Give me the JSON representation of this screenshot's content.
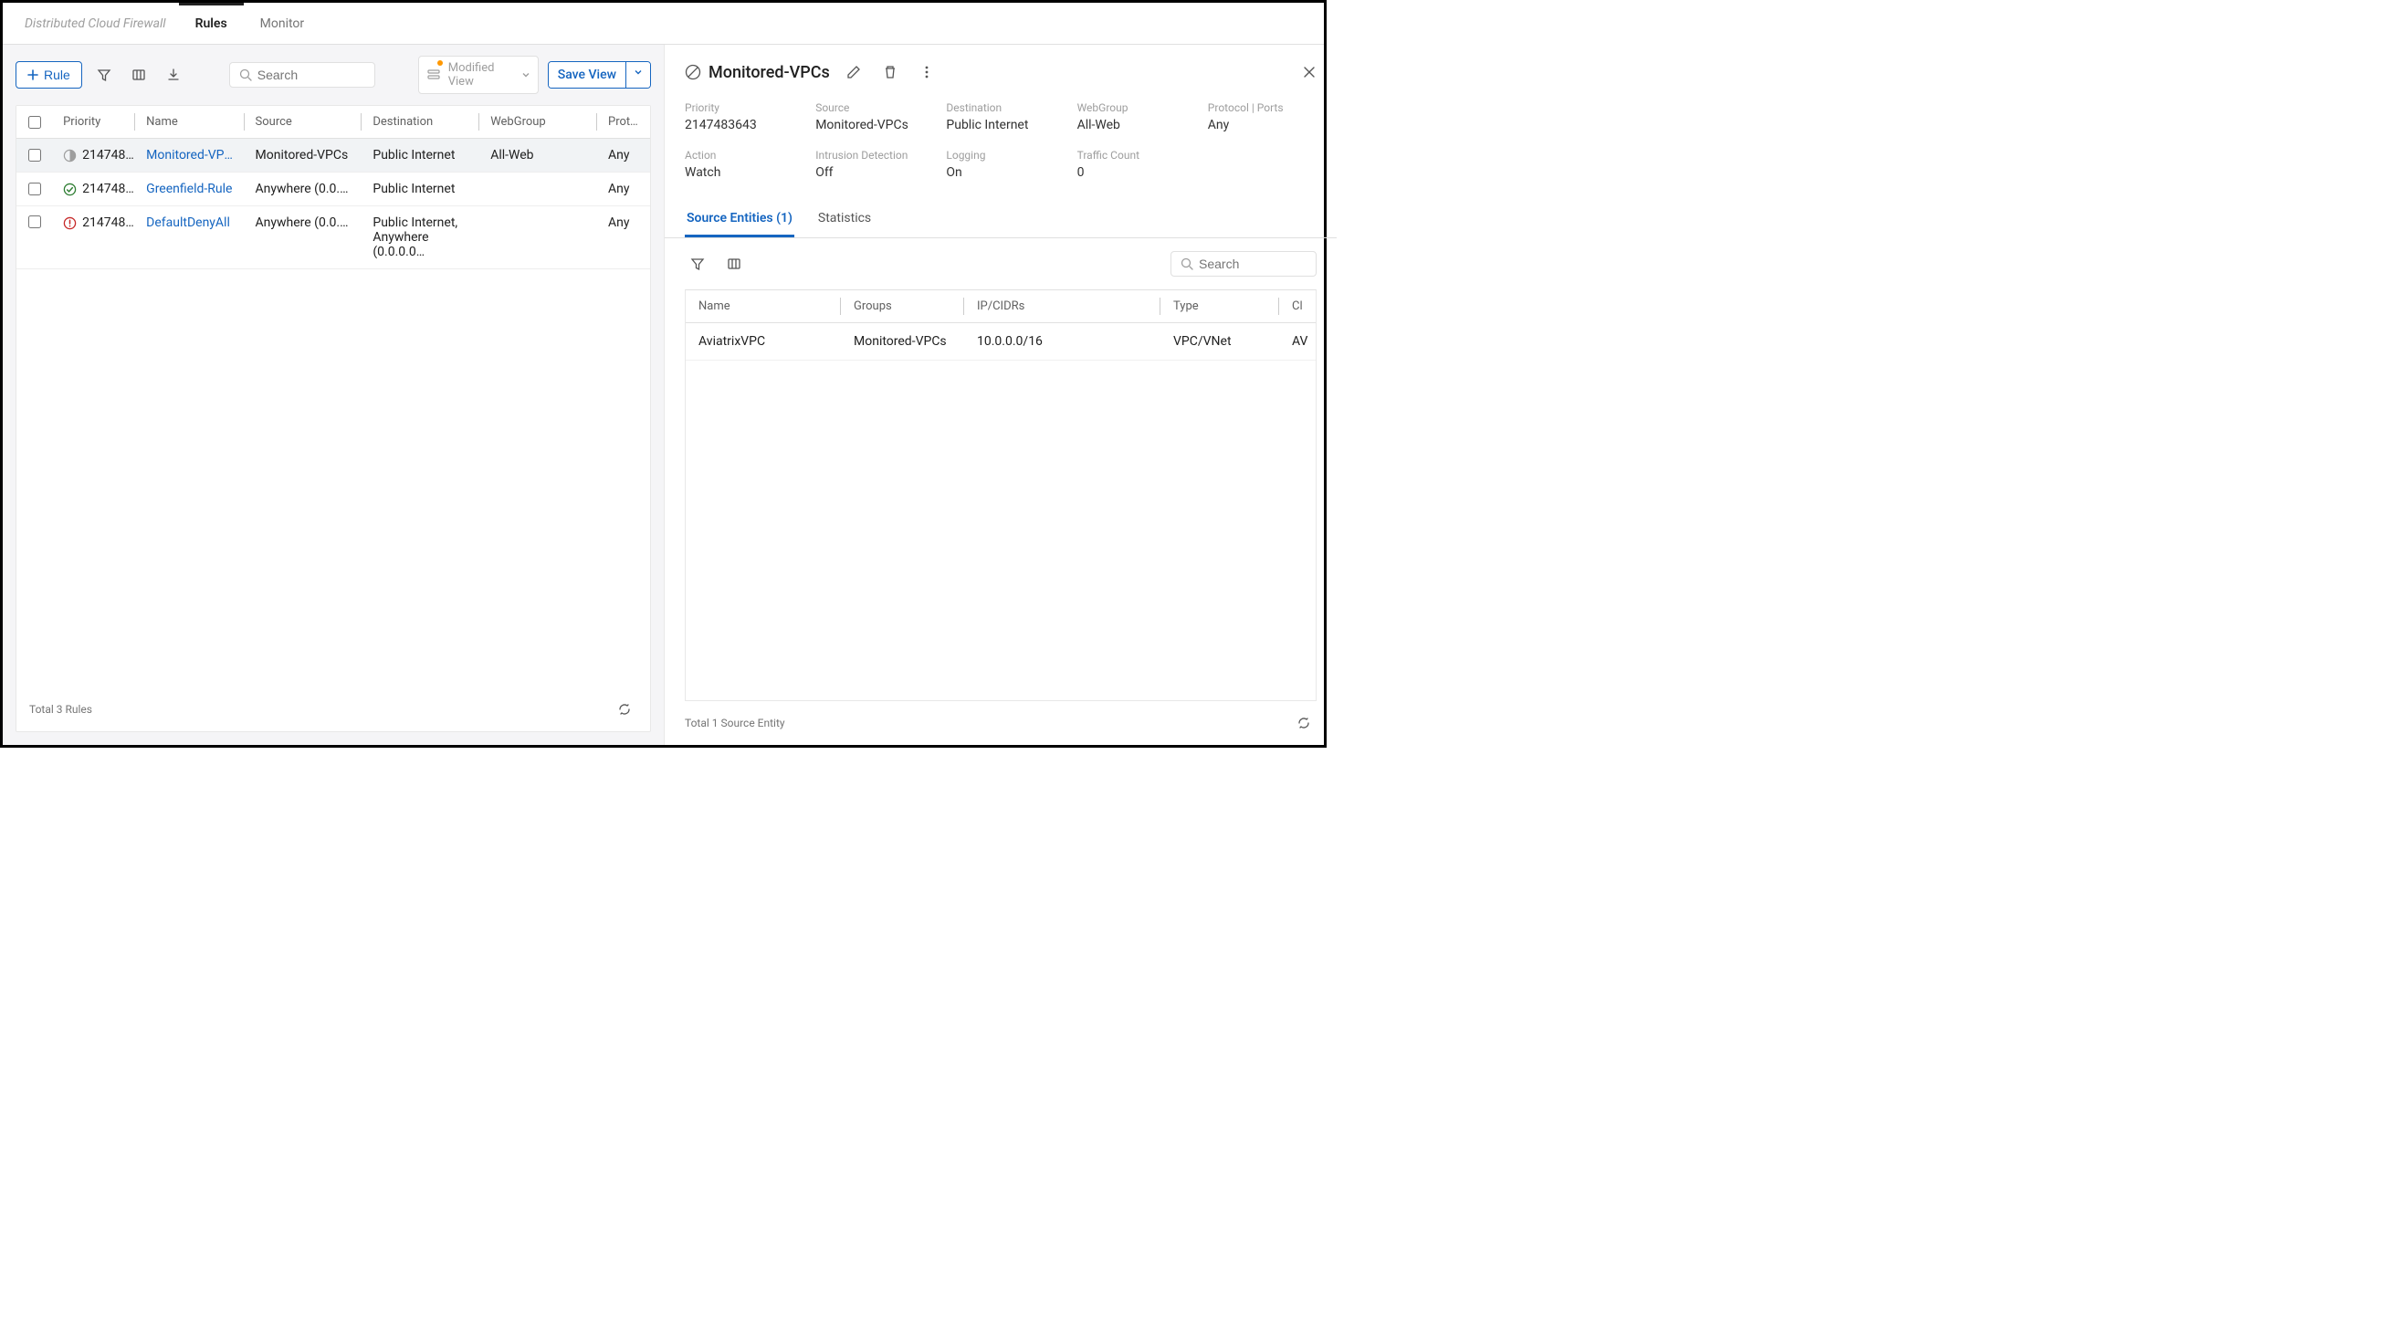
{
  "header": {
    "brand": "Distributed Cloud Firewall",
    "tabs": [
      "Rules",
      "Monitor"
    ],
    "active_tab": "Rules"
  },
  "toolbar": {
    "add_rule_label": "Rule",
    "search_placeholder": "Search",
    "modified_view_label": "Modified View",
    "save_view_label": "Save View"
  },
  "rules_table": {
    "columns": [
      "Priority",
      "Name",
      "Source",
      "Destination",
      "WebGroup",
      "Protoc"
    ],
    "rows": [
      {
        "priority": "214748…",
        "name": "Monitored-VPCs",
        "source": "Monitored-VPCs",
        "destination": "Public Internet",
        "webgroup": "All-Web",
        "protocol": "Any",
        "status": "watch",
        "selected": true
      },
      {
        "priority": "214748…",
        "name": "Greenfield-Rule",
        "source": "Anywhere (0.0.0.0…",
        "destination": "Public Internet",
        "webgroup": "",
        "protocol": "Any",
        "status": "allow",
        "selected": false
      },
      {
        "priority": "214748…",
        "name": "DefaultDenyAll",
        "source": "Anywhere (0.0.0.0…",
        "destination": "Public Internet, Anywhere (0.0.0.0…",
        "webgroup": "",
        "protocol": "Any",
        "status": "deny",
        "selected": false
      }
    ],
    "footer": "Total 3 Rules"
  },
  "detail": {
    "title": "Monitored-VPCs",
    "meta": {
      "Priority": "2147483643",
      "Source": "Monitored-VPCs",
      "Destination": "Public Internet",
      "WebGroup": "All-Web",
      "Protocol | Ports": "Any",
      "Action": "Watch",
      "Intrusion Detection": "Off",
      "Logging": "On",
      "Traffic Count": "0"
    },
    "sub_tabs": {
      "source_entities": "Source Entities (1)",
      "statistics": "Statistics"
    },
    "entity_search_placeholder": "Search",
    "entity_table": {
      "columns": [
        "Name",
        "Groups",
        "IP/CIDRs",
        "Type",
        "Cl"
      ],
      "rows": [
        {
          "name": "AviatrixVPC",
          "groups": "Monitored-VPCs",
          "ip": "10.0.0.0/16",
          "type": "VPC/VNet",
          "cloud": "AV"
        }
      ],
      "footer": "Total 1 Source Entity"
    }
  }
}
